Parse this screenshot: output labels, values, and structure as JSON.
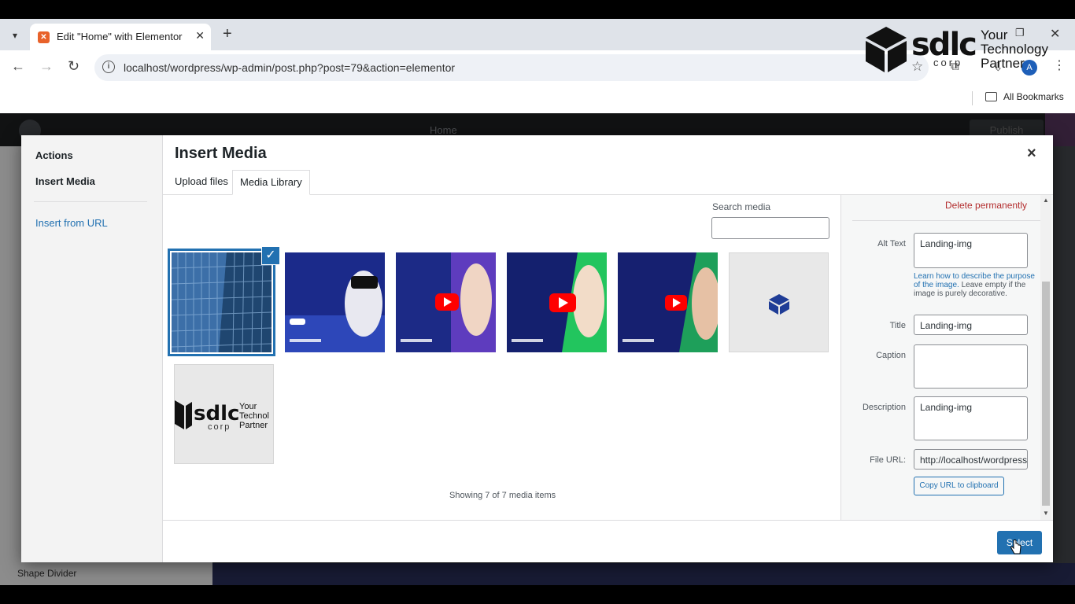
{
  "browser": {
    "tab_title": "Edit \"Home\" with Elementor",
    "url": "localhost/wordpress/wp-admin/post.php?post=79&action=elementor",
    "profile_initial": "A",
    "bookmarks_label": "All Bookmarks"
  },
  "watermark": {
    "word": "sdlc",
    "sub": "corp",
    "tag_line1": "Your",
    "tag_line2": "Technology",
    "tag_line3": "Partner"
  },
  "elementor": {
    "page_name": "Home",
    "publish_label": "Publish",
    "panel_item": "Shape Divider"
  },
  "modal": {
    "sidebar": {
      "heading": "Actions",
      "active_item": "Insert Media",
      "link": "Insert from URL"
    },
    "title": "Insert Media",
    "close": "×",
    "tabs": [
      "Upload files",
      "Media Library"
    ],
    "search_label": "Search media",
    "search_value": "",
    "showing": "Showing 7 of 7 media items",
    "media_items": [
      {
        "kind": "building",
        "selected": true
      },
      {
        "kind": "video",
        "caption": "AVERSE THCARE TIONS",
        "colors": [
          "#1b2a8a",
          "#3b5bd9"
        ]
      },
      {
        "kind": "video",
        "caption": "LOPMENT PANY",
        "colors": [
          "#1c2a86",
          "#7a44d6"
        ]
      },
      {
        "kind": "video",
        "caption": "ILE APP ELOPMENT ICES",
        "colors": [
          "#14206e",
          "#22c55e"
        ]
      },
      {
        "kind": "video",
        "caption": "Y TO USE TACT M 7 IN DPRESS",
        "colors": [
          "#162070",
          "#1e9f5a"
        ]
      },
      {
        "kind": "cube-logo"
      },
      {
        "kind": "sdlc-logo"
      }
    ],
    "thumb_texts": {
      "logo_word": "sdlc",
      "logo_sub": "corp",
      "logo_tag1": "Your",
      "logo_tag2": "Technol",
      "logo_tag3": "Partner"
    },
    "details": {
      "delete_label": "Delete permanently",
      "alt_label": "Alt Text",
      "alt_value": "Landing-img",
      "help_link": "Learn how to describe the purpose of the image.",
      "help_text": "Leave empty if the image is purely decorative.",
      "title_label": "Title",
      "title_value": "Landing-img",
      "caption_label": "Caption",
      "caption_value": "",
      "description_label": "Description",
      "description_value": "Landing-img",
      "file_url_label": "File URL:",
      "file_url_value": "http://localhost/wordpress",
      "copy_label": "Copy URL to clipboard"
    },
    "select_label": "Select"
  },
  "colors": {
    "wp_blue": "#2271b1",
    "danger": "#b32d2e"
  }
}
